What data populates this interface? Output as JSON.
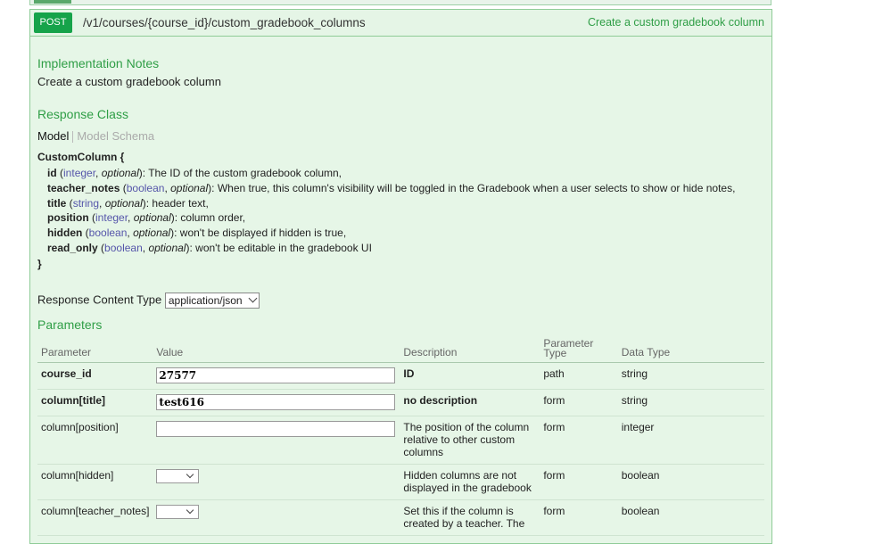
{
  "operation": {
    "method": "POST",
    "path": "/v1/courses/{course_id}/custom_gradebook_columns",
    "summary": "Create a custom gradebook column"
  },
  "implementation_notes": {
    "title": "Implementation Notes",
    "text": "Create a custom gradebook column"
  },
  "response_class": {
    "title": "Response Class",
    "tab_model": "Model",
    "tab_schema": "Model Schema",
    "model_name": "CustomColumn {",
    "closing_brace": "}",
    "properties": [
      {
        "name": "id",
        "type": "integer",
        "optional": "optional",
        "desc": ": The ID of the custom gradebook column,"
      },
      {
        "name": "teacher_notes",
        "type": "boolean",
        "optional": "optional",
        "desc": ": When true, this column's visibility will be toggled in the Gradebook when a user selects to show or hide notes,"
      },
      {
        "name": "title",
        "type": "string",
        "optional": "optional",
        "desc": ": header text,"
      },
      {
        "name": "position",
        "type": "integer",
        "optional": "optional",
        "desc": ": column order,"
      },
      {
        "name": "hidden",
        "type": "boolean",
        "optional": "optional",
        "desc": ": won't be displayed if hidden is true,"
      },
      {
        "name": "read_only",
        "type": "boolean",
        "optional": "optional",
        "desc": ": won't be editable in the gradebook UI"
      }
    ]
  },
  "response_content_type": {
    "label": "Response Content Type",
    "value": "application/json"
  },
  "parameters": {
    "title": "Parameters",
    "headers": {
      "parameter": "Parameter",
      "value": "Value",
      "description": "Description",
      "param_type": "Parameter Type",
      "data_type": "Data Type"
    },
    "rows": [
      {
        "name": "course_id",
        "value": "27577",
        "description": "ID",
        "param_type": "path",
        "data_type": "string"
      },
      {
        "name": "column[title]",
        "value": "test616",
        "description": "no description",
        "param_type": "form",
        "data_type": "string"
      },
      {
        "name": "column[position]",
        "value": "",
        "description": "The position of the column relative to other custom columns",
        "param_type": "form",
        "data_type": "integer"
      },
      {
        "name": "column[hidden]",
        "value": "",
        "description": "Hidden columns are not displayed in the gradebook",
        "param_type": "form",
        "data_type": "boolean"
      },
      {
        "name": "column[teacher_notes]",
        "value": "",
        "description": "Set this if the column is created by a teacher. The",
        "param_type": "form",
        "data_type": "boolean"
      }
    ]
  },
  "colors": {
    "accent_green": "#2f9e46",
    "method_badge": "#16a34a",
    "panel_bg": "#e6f6e7"
  }
}
